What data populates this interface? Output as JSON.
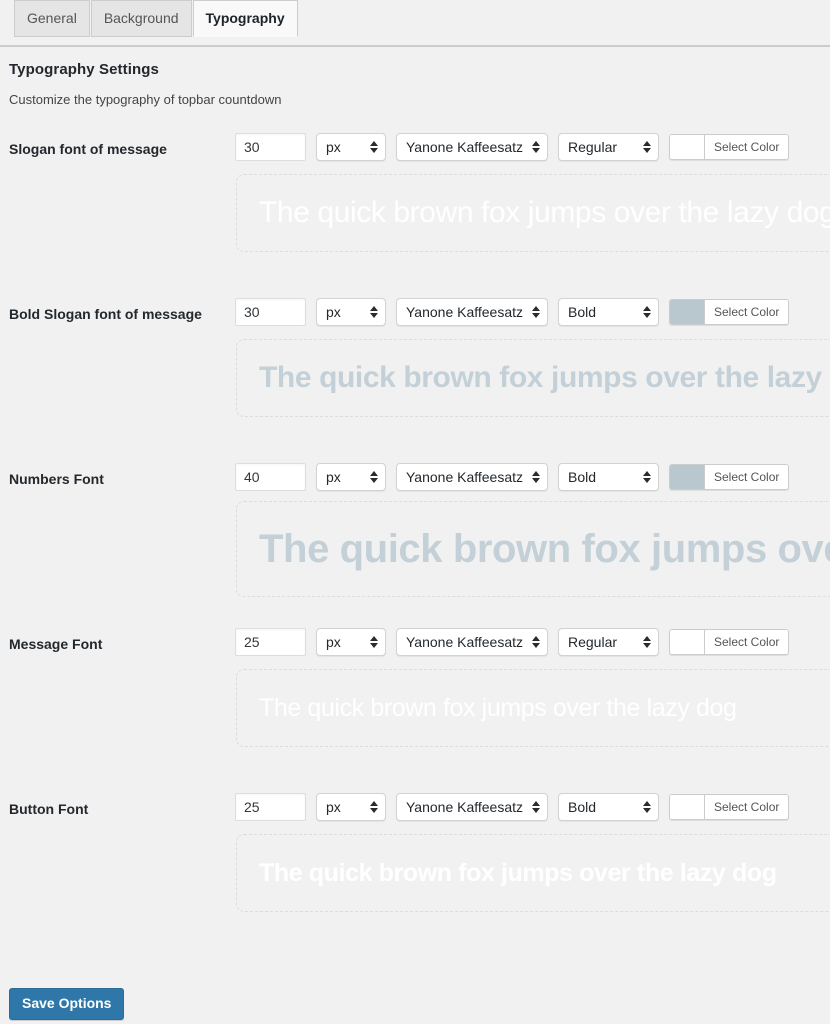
{
  "tabs": [
    {
      "label": "General",
      "active": false
    },
    {
      "label": "Background",
      "active": false
    },
    {
      "label": "Typography",
      "active": true
    }
  ],
  "header": {
    "title": "Typography Settings",
    "description": "Customize the typography of topbar countdown"
  },
  "common": {
    "select_color_label": "Select Color",
    "preview_text": "The quick brown fox jumps over the lazy dog",
    "unit_value": "px",
    "font_family_value": "Yanone Kaffeesatz"
  },
  "rows": [
    {
      "label": "Slogan font of message",
      "size": "30",
      "unit": "px",
      "family": "Yanone Kaffeesatz",
      "weight": "Regular",
      "color": "#ffffff",
      "select_color": "Select Color",
      "preview_text": "The quick brown fox jumps over the lazy dog",
      "preview_size_px": "30",
      "preview_bold": false,
      "preview_color": "#ffffff"
    },
    {
      "label": "Bold Slogan font of message",
      "size": "30",
      "unit": "px",
      "family": "Yanone Kaffeesatz",
      "weight": "Bold",
      "color": "#b9c7ce",
      "select_color": "Select Color",
      "preview_text": "The quick brown fox jumps over the lazy dog",
      "preview_size_px": "30",
      "preview_bold": true,
      "preview_color": "#c3d0d7"
    },
    {
      "label": "Numbers Font",
      "size": "40",
      "unit": "px",
      "family": "Yanone Kaffeesatz",
      "weight": "Bold",
      "color": "#b9c7ce",
      "select_color": "Select Color",
      "preview_text": "The quick brown fox jumps over the lazy dog",
      "preview_size_px": "40",
      "preview_bold": true,
      "preview_color": "#c3d0d7"
    },
    {
      "label": "Message Font",
      "size": "25",
      "unit": "px",
      "family": "Yanone Kaffeesatz",
      "weight": "Regular",
      "color": "#ffffff",
      "select_color": "Select Color",
      "preview_text": "The quick brown fox jumps over the lazy dog",
      "preview_size_px": "25",
      "preview_bold": false,
      "preview_color": "#ffffff"
    },
    {
      "label": "Button Font",
      "size": "25",
      "unit": "px",
      "family": "Yanone Kaffeesatz",
      "weight": "Bold",
      "color": "#ffffff",
      "select_color": "Select Color",
      "preview_text": "The quick brown fox jumps over the lazy dog",
      "preview_size_px": "25",
      "preview_bold": true,
      "preview_color": "#ffffff"
    }
  ],
  "footer": {
    "save_label": "Save Options",
    "save_color": "#2e77a8"
  }
}
